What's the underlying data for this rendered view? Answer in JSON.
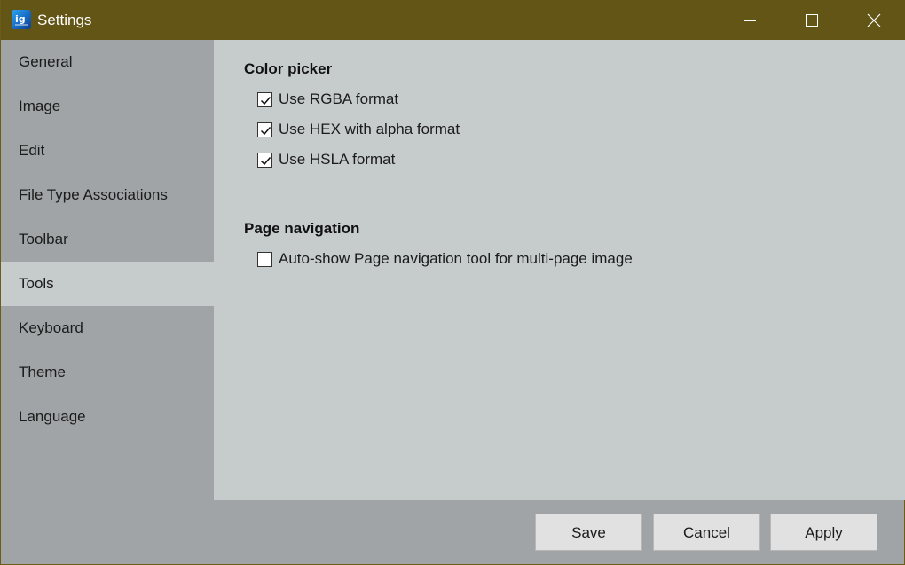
{
  "window": {
    "title": "Settings",
    "app_icon": "imageglass-icon",
    "controls": [
      "minimize-icon",
      "maximize-icon",
      "close-icon"
    ]
  },
  "sidebar": {
    "items": [
      {
        "label": "General"
      },
      {
        "label": "Image"
      },
      {
        "label": "Edit"
      },
      {
        "label": "File Type Associations"
      },
      {
        "label": "Toolbar"
      },
      {
        "label": "Tools",
        "active": true
      },
      {
        "label": "Keyboard"
      },
      {
        "label": "Theme"
      },
      {
        "label": "Language"
      }
    ]
  },
  "content": {
    "color_picker": {
      "title": "Color picker",
      "options": [
        {
          "label": "Use RGBA format",
          "checked": true
        },
        {
          "label": "Use HEX with alpha format",
          "checked": true
        },
        {
          "label": "Use HSLA format",
          "checked": true
        }
      ]
    },
    "page_navigation": {
      "title": "Page navigation",
      "options": [
        {
          "label": "Auto-show Page navigation tool for multi-page image",
          "checked": false
        }
      ]
    }
  },
  "footer": {
    "save_label": "Save",
    "cancel_label": "Cancel",
    "apply_label": "Apply"
  },
  "colors": {
    "titlebar": "#635515",
    "sidebar": "#a0a4a7",
    "content": "#c6cbcb",
    "active_item": "#c6cbcb",
    "button": "#e1e1e1"
  }
}
